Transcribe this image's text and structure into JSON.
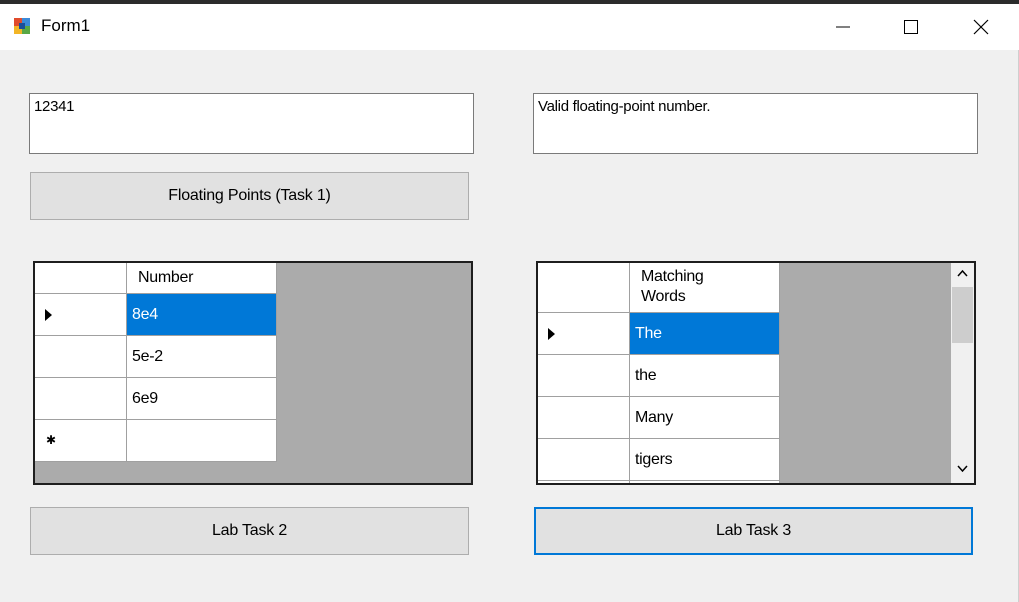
{
  "window": {
    "title": "Form1",
    "icons": {
      "app": "winforms-app-icon",
      "minimize": "minimize-icon",
      "maximize": "maximize-icon",
      "close": "close-icon"
    }
  },
  "task1": {
    "input_value": "12341",
    "output_value": "Valid floating-point number.",
    "button_label": "Floating Points (Task 1)"
  },
  "grid1": {
    "header": "Number",
    "rows": [
      "8e4",
      "5e-2",
      "6e9",
      ""
    ]
  },
  "grid2": {
    "header_line1": "Matching",
    "header_line2": "Words",
    "rows": [
      "The",
      "the",
      "Many",
      "tigers"
    ]
  },
  "buttons": {
    "lab_task_2": "Lab Task 2",
    "lab_task_3": "Lab Task 3"
  },
  "colors": {
    "accent": "#0078d7",
    "grid_bg": "#ababab"
  }
}
